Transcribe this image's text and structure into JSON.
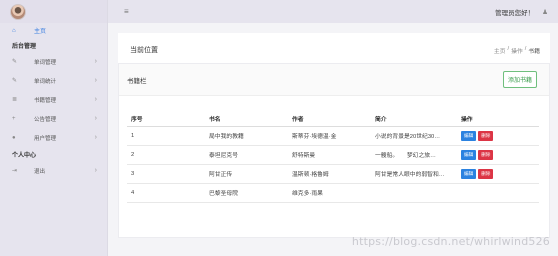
{
  "topbar": {
    "menu_icon": "hamburger-icon",
    "greeting": "管理员您好！",
    "user_icon": "user-icon"
  },
  "sidebar": {
    "home": {
      "label": "主页",
      "icon": "home-icon"
    },
    "sections": [
      {
        "title": "后台管理",
        "items": [
          {
            "label": "单词管理",
            "icon": "edit-icon"
          },
          {
            "label": "单词统计",
            "icon": "edit-icon"
          },
          {
            "label": "书籍管理",
            "icon": "list-icon"
          },
          {
            "label": "公告管理",
            "icon": "plus-icon"
          },
          {
            "label": "用户管理",
            "icon": "user-icon"
          }
        ]
      },
      {
        "title": "个人中心",
        "items": [
          {
            "label": "退出",
            "icon": "logout-icon"
          }
        ]
      }
    ]
  },
  "header": {
    "position_label": "当前位置",
    "breadcrumb": [
      "主页",
      "操作",
      "书籍"
    ]
  },
  "card": {
    "title": "书籍栏",
    "add_button": "添加书籍"
  },
  "table": {
    "columns": [
      "序号",
      "书名",
      "作者",
      "简介",
      "操作"
    ],
    "rows": [
      {
        "id": "1",
        "name": "局中我的教籍",
        "author": "斯蒂芬·埃德温·金",
        "summary": "小说的背景是20世纪30…",
        "actions": [
          "编辑",
          "删除"
        ]
      },
      {
        "id": "2",
        "name": "泰坦尼克号",
        "author": "舒特斯曼",
        "summary": "一艘船。　　梦幻之旅…",
        "actions": [
          "编辑",
          "删除"
        ]
      },
      {
        "id": "3",
        "name": "阿甘正传",
        "author": "温斯顿·格鲁姆",
        "summary": "阿甘是常人眼中的弱智和…",
        "actions": [
          "编辑",
          "删除"
        ]
      },
      {
        "id": "4",
        "name": "巴黎圣母院",
        "author": "维克多·雨果",
        "summary": "",
        "actions": []
      }
    ]
  },
  "watermark": "https://blog.csdn.net/whirlwind526"
}
